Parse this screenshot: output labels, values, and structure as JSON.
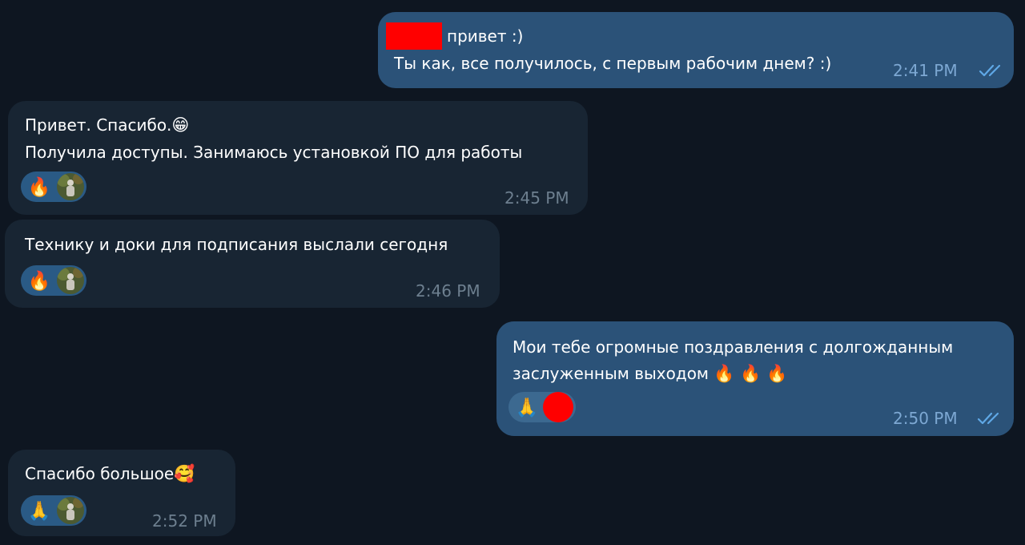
{
  "colors": {
    "background": "#0e1621",
    "incoming_bubble": "#182533",
    "outgoing_bubble": "#2b5278",
    "read_ticks": "#5fa8e6",
    "redaction": "#ff0000"
  },
  "messages": [
    {
      "direction": "outgoing",
      "line1": "привет :)",
      "line2": "Ты как, все получилось, с первым рабочим днем? :)",
      "time": "2:41 PM",
      "status_icon": "double-check-icon"
    },
    {
      "direction": "incoming",
      "line1": "Привет. Спасибо.",
      "line1_emoji": "😁",
      "line2": "Получила доступы. Занимаюсь установкой ПО для работы",
      "reaction_emoji": "🔥",
      "time": "2:45 PM"
    },
    {
      "direction": "incoming",
      "line1": "Технику и доки для подписания выслали сегодня",
      "reaction_emoji": "🔥",
      "time": "2:46 PM"
    },
    {
      "direction": "outgoing",
      "line1": "Мои тебе огромные поздравления с долгожданным",
      "line2": "заслуженным выходом",
      "line2_emoji": "🔥 🔥 🔥",
      "reaction_emoji": "🙏",
      "time": "2:50 PM",
      "status_icon": "double-check-icon"
    },
    {
      "direction": "incoming",
      "line1": "Спасибо большое",
      "line1_emoji": "🥰",
      "reaction_emoji": "🙏",
      "time": "2:52 PM"
    }
  ]
}
